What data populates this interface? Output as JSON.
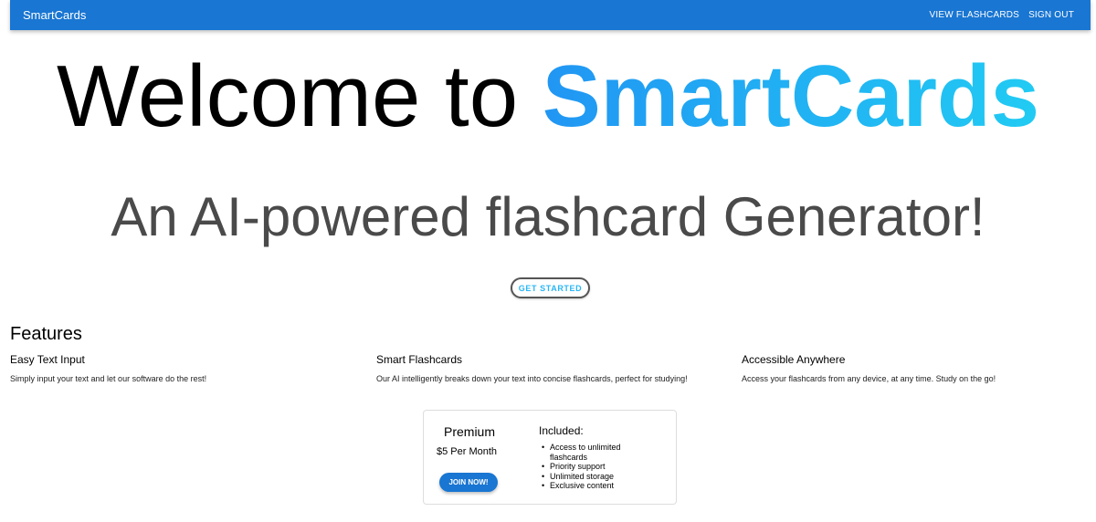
{
  "appbar": {
    "brand": "SmartCards",
    "nav": [
      {
        "label": "VIEW FLASHCARDS"
      },
      {
        "label": "SIGN OUT"
      }
    ]
  },
  "hero": {
    "title_prefix": "Welcome to ",
    "title_accent": "SmartCards",
    "subtitle": "An AI-powered flashcard Generator!",
    "cta_label": "GET STARTED",
    "accent_gradient": [
      "#2196f3",
      "#21cbf3"
    ]
  },
  "features": {
    "heading": "Features",
    "items": [
      {
        "title": "Easy Text Input",
        "description": "Simply input your text and let our software do the rest!"
      },
      {
        "title": "Smart Flashcards",
        "description": "Our AI intelligently breaks down your text into concise flashcards, perfect for studying!"
      },
      {
        "title": "Accessible Anywhere",
        "description": "Access your flashcards from any device, at any time. Study on the go!"
      }
    ]
  },
  "pricing": {
    "plan_name": "Premium",
    "price": "$5 Per Month",
    "button_label": "JOIN NOW!",
    "included_heading": "Included:",
    "included": [
      "Access to unlimited flashcards",
      "Priority support",
      "Unlimited storage",
      "Exclusive content"
    ]
  },
  "colors": {
    "primary": "#1976d2",
    "subtitle_text": "#4a4a4a",
    "cta_text": "#29b6f6"
  }
}
